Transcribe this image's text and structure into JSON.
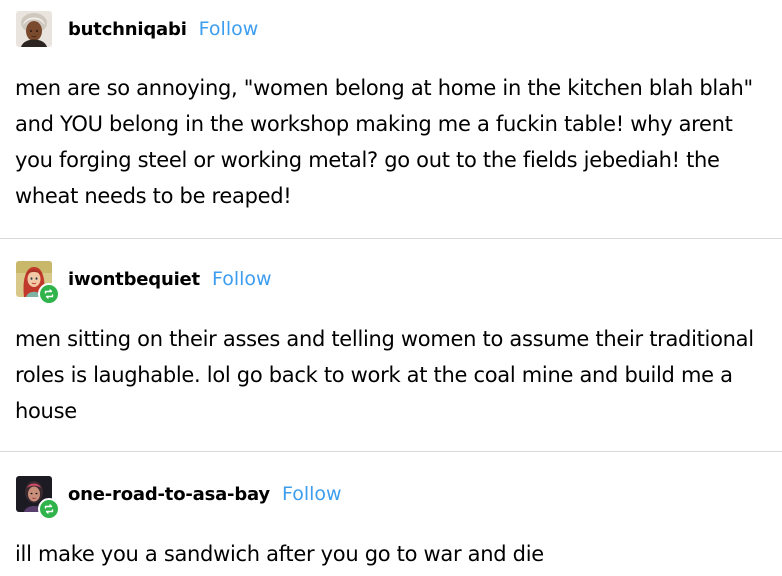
{
  "posts": [
    {
      "username": "butchniqabi",
      "follow_label": "Follow",
      "reblogged": false,
      "avatar_icon": "user-avatar-portrait",
      "body": "men are so annoying, \"women belong at home in the kitchen blah blah\" and YOU belong in the workshop making me a fuckin table! why arent you forging steel or working metal? go out to the fields jebediah! the wheat needs to be reaped!"
    },
    {
      "username": "iwontbequiet",
      "follow_label": "Follow",
      "reblogged": true,
      "avatar_icon": "user-avatar-cartoon",
      "body": "men sitting on their asses and telling women to assume their traditional roles is laughable. lol go back to work at the coal mine and build me a house"
    },
    {
      "username": "one-road-to-asa-bay",
      "follow_label": "Follow",
      "reblogged": true,
      "avatar_icon": "user-avatar-portrait",
      "body": "ill make you a sandwich after you go to war and die"
    }
  ],
  "colors": {
    "follow": "#3d9ef0",
    "reblog_badge": "#2fb34a",
    "divider": "#d9d9d9",
    "text": "#000000"
  },
  "icons": {
    "reblog": "reblog-icon"
  }
}
